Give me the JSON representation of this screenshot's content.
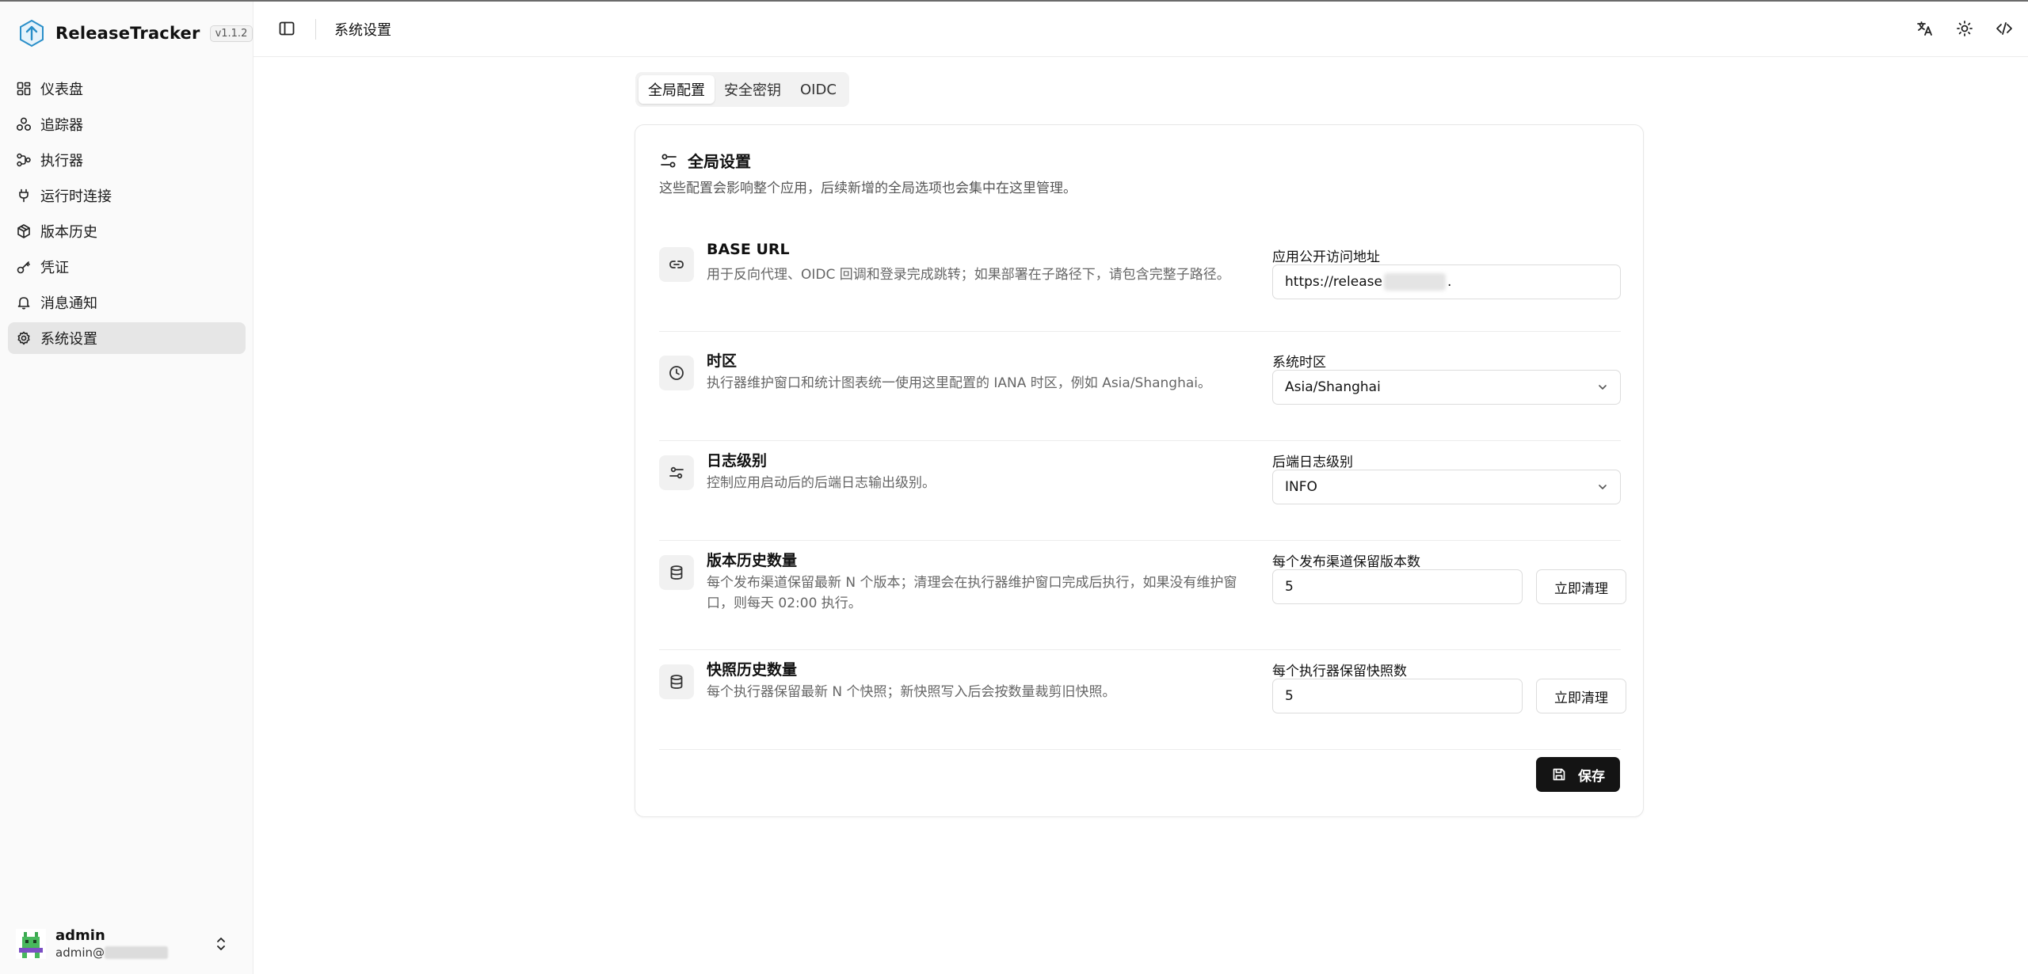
{
  "app": {
    "name": "ReleaseTracker",
    "version": "v1.1.2"
  },
  "sidebar": {
    "items": [
      {
        "label": "仪表盘",
        "icon": "dashboard-icon"
      },
      {
        "label": "追踪器",
        "icon": "tracker-icon"
      },
      {
        "label": "执行器",
        "icon": "executor-icon"
      },
      {
        "label": "运行时连接",
        "icon": "plug-icon"
      },
      {
        "label": "版本历史",
        "icon": "package-icon"
      },
      {
        "label": "凭证",
        "icon": "key-icon"
      },
      {
        "label": "消息通知",
        "icon": "bell-icon"
      },
      {
        "label": "系统设置",
        "icon": "gear-icon",
        "active": true
      }
    ]
  },
  "user": {
    "name": "admin",
    "email_prefix": "admin@"
  },
  "header": {
    "title": "系统设置"
  },
  "tabs": [
    {
      "label": "全局配置",
      "active": true
    },
    {
      "label": "安全密钥"
    },
    {
      "label": "OIDC"
    }
  ],
  "card": {
    "title": "全局设置",
    "description": "这些配置会影响整个应用，后续新增的全局选项也会集中在这里管理。"
  },
  "settings": {
    "base_url": {
      "title": "BASE URL",
      "description": "用于反向代理、OIDC 回调和登录完成跳转；如果部署在子路径下，请包含完整子路径。",
      "field_label": "应用公开访问地址",
      "value_prefix": "https://release",
      "value_suffix": "."
    },
    "timezone": {
      "title": "时区",
      "description": "执行器维护窗口和统计图表统一使用这里配置的 IANA 时区，例如 Asia/Shanghai。",
      "field_label": "系统时区",
      "value": "Asia/Shanghai"
    },
    "log_level": {
      "title": "日志级别",
      "description": "控制应用启动后的后端日志输出级别。",
      "field_label": "后端日志级别",
      "value": "INFO"
    },
    "version_history": {
      "title": "版本历史数量",
      "description": "每个发布渠道保留最新 N 个版本；清理会在执行器维护窗口完成后执行，如果没有维护窗口，则每天 02:00 执行。",
      "field_label": "每个发布渠道保留版本数",
      "value": "5",
      "button": "立即清理"
    },
    "snapshot_history": {
      "title": "快照历史数量",
      "description": "每个执行器保留最新 N 个快照；新快照写入后会按数量裁剪旧快照。",
      "field_label": "每个执行器保留快照数",
      "value": "5",
      "button": "立即清理"
    }
  },
  "save_button": "保存"
}
